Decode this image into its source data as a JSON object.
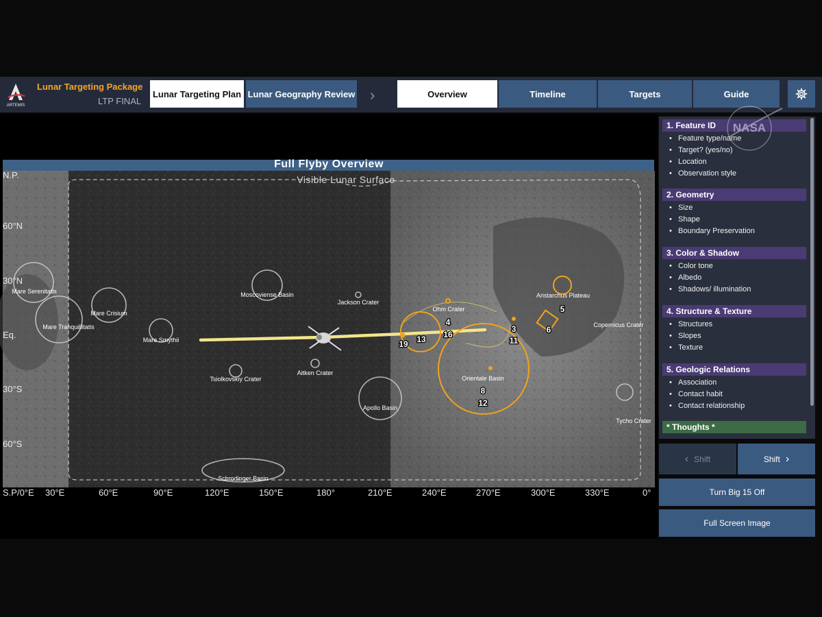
{
  "header": {
    "org_label": "ARTEMIS",
    "package_title": "Lunar Targeting Package",
    "package_subtitle": "LTP FINAL",
    "tabs_left": [
      "Lunar Targeting Plan",
      "Lunar Geography Review"
    ],
    "tabs_right": [
      "Overview",
      "Timeline",
      "Targets",
      "Guide"
    ],
    "active_tab": "Overview",
    "watermark": "NASA"
  },
  "map": {
    "title": "Full Flyby Overview",
    "subtitle": "Visible Lunar Surface",
    "lat_labels": [
      "N.P.",
      "60°N",
      "30°N",
      "Eq.",
      "30°S",
      "60°S"
    ],
    "lon_labels": [
      "S.P/0°E",
      "30°E",
      "60°E",
      "90°E",
      "120°E",
      "150°E",
      "180°",
      "210°E",
      "240°E",
      "270°E",
      "300°E",
      "330°E",
      "0°"
    ],
    "features": {
      "serenitatis": "Mare Serenitatis",
      "crisium": "Mare Crisium",
      "tranquillitatis": "Mare Tranquillitatis",
      "smythii": "Mare Smythii",
      "moscoviense": "Moscoviense Basin",
      "jackson": "Jackson Crater",
      "tsiolkovskiy": "Tsiolkovskiy Crater",
      "aitken": "Aitken Crater",
      "apollo": "Apollo Basin",
      "schrodinger": "Schrodinger Basin",
      "ohm": "Ohm Crater",
      "orientale": "Orientale Basin",
      "aristarchus": "Aristarchus Plateau",
      "copernicus": "Copernicus Crater",
      "tycho": "Tycho Crater"
    },
    "targets": {
      "t3": "3",
      "t4": "4",
      "t5": "5",
      "t6": "6",
      "t8": "8",
      "t11": "11",
      "t12": "12",
      "t13": "13",
      "t16": "16",
      "t19": "19"
    },
    "colors": {
      "target": "#f2a31b",
      "trajectory": "#f3e58a",
      "title_bar": "#3e6187"
    }
  },
  "checklist": {
    "sections": [
      {
        "title": "1. Feature ID",
        "items": [
          "Feature type/name",
          "Target? (yes/no)",
          "Location",
          "Observation style"
        ]
      },
      {
        "title": "2. Geometry",
        "items": [
          "Size",
          "Shape",
          "Boundary Preservation"
        ]
      },
      {
        "title": "3. Color & Shadow",
        "items": [
          "Color tone",
          "Albedo",
          "Shadows/ illumination"
        ]
      },
      {
        "title": "4. Structure & Texture",
        "items": [
          "Structures",
          "Slopes",
          "Texture"
        ]
      },
      {
        "title": "5. Geologic Relations",
        "items": [
          "Association",
          "Contact habit",
          "Contact relationship"
        ]
      },
      {
        "title": "* Thoughts *",
        "items": []
      }
    ]
  },
  "controls": {
    "shift_prev": "Shift",
    "shift_next": "Shift",
    "turn_off": "Turn Big 15 Off",
    "full_screen": "Full Screen Image"
  }
}
